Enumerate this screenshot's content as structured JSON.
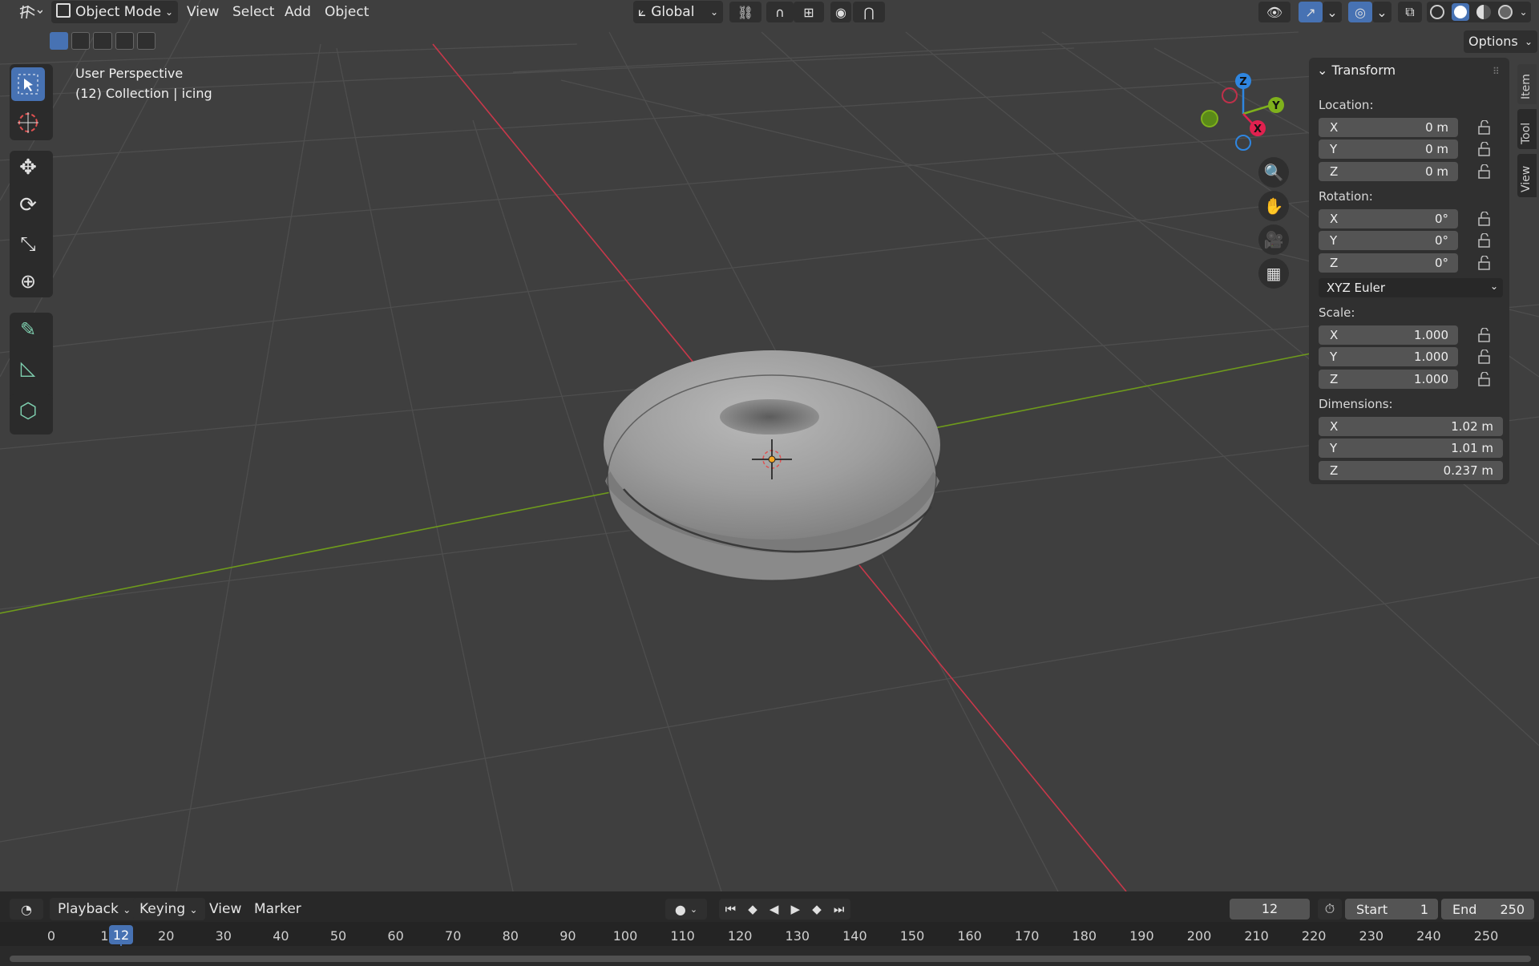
{
  "header": {
    "editor_type_icon": "3d-viewport-grid-icon",
    "mode": "Object Mode",
    "menus": [
      "View",
      "Select",
      "Add",
      "Object"
    ],
    "orientation": "Global",
    "options": "Options"
  },
  "viewport": {
    "perspective": "User Perspective",
    "collection": "(12) Collection | icing"
  },
  "gizmo": {
    "z": "Z",
    "y": "Y",
    "x": "X"
  },
  "npanel": {
    "title": "Transform",
    "location_label": "Location:",
    "location": [
      {
        "axis": "X",
        "value": "0 m"
      },
      {
        "axis": "Y",
        "value": "0 m"
      },
      {
        "axis": "Z",
        "value": "0 m"
      }
    ],
    "rotation_label": "Rotation:",
    "rotation": [
      {
        "axis": "X",
        "value": "0°"
      },
      {
        "axis": "Y",
        "value": "0°"
      },
      {
        "axis": "Z",
        "value": "0°"
      }
    ],
    "rotation_mode": "XYZ Euler",
    "scale_label": "Scale:",
    "scale": [
      {
        "axis": "X",
        "value": "1.000"
      },
      {
        "axis": "Y",
        "value": "1.000"
      },
      {
        "axis": "Z",
        "value": "1.000"
      }
    ],
    "dimensions_label": "Dimensions:",
    "dimensions": [
      {
        "axis": "X",
        "value": "1.02 m"
      },
      {
        "axis": "Y",
        "value": "1.01 m"
      },
      {
        "axis": "Z",
        "value": "0.237 m"
      }
    ]
  },
  "sidetabs": [
    "Item",
    "Tool",
    "View"
  ],
  "timeline": {
    "menus": [
      "Playback",
      "Keying",
      "View",
      "Marker"
    ],
    "current_frame": "12",
    "start_label": "Start",
    "start": "1",
    "end_label": "End",
    "end": "250",
    "ruler": [
      "0",
      "10",
      "20",
      "30",
      "40",
      "50",
      "60",
      "70",
      "80",
      "90",
      "100",
      "110",
      "120",
      "130",
      "140",
      "150",
      "160",
      "170",
      "180",
      "190",
      "200",
      "210",
      "220",
      "230",
      "240",
      "250"
    ],
    "playhead": "12"
  },
  "colors": {
    "accent": "#4772b3",
    "x_axis": "#c7384a",
    "y_axis": "#6e9a1c",
    "gizmo_z": "#2f86e0",
    "gizmo_y": "#7fb11c",
    "gizmo_x": "#e0214f"
  }
}
